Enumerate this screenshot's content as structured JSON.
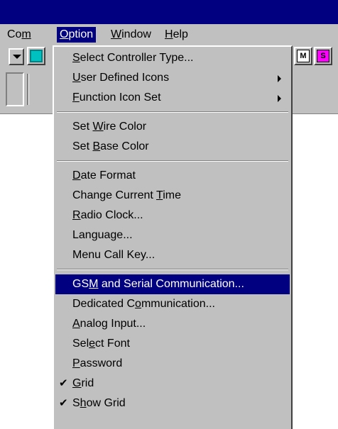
{
  "menubar": {
    "items": [
      {
        "label": "Com",
        "mnemonic_index": 2
      },
      {
        "label": "Option",
        "mnemonic_index": 0,
        "active": true
      },
      {
        "label": "Window",
        "mnemonic_index": 0
      },
      {
        "label": "Help",
        "mnemonic_index": 0
      }
    ]
  },
  "toolbar": {
    "icons": [
      {
        "name": "toolbar-partial-icon",
        "glyph": "",
        "color": "#008080"
      },
      {
        "name": "toolbar-m-icon",
        "glyph": "M",
        "color": "#000000"
      },
      {
        "name": "toolbar-s-icon",
        "glyph": "S",
        "color": "#800080"
      }
    ]
  },
  "option_menu": {
    "groups": [
      [
        {
          "label": "Select Controller Type...",
          "mnemonic_index": 0,
          "submenu": false
        },
        {
          "label": "User Defined Icons",
          "mnemonic_index": 0,
          "submenu": true
        },
        {
          "label": "Function Icon Set",
          "mnemonic_index": 0,
          "submenu": true
        }
      ],
      [
        {
          "label": "Set Wire Color",
          "mnemonic_index": 4,
          "submenu": false
        },
        {
          "label": "Set Base Color",
          "mnemonic_index": 4,
          "submenu": false
        }
      ],
      [
        {
          "label": "Date Format",
          "mnemonic_index": 0,
          "submenu": false
        },
        {
          "label": "Change Current Time",
          "mnemonic_index": 15,
          "submenu": false
        },
        {
          "label": "Radio Clock...",
          "mnemonic_index": 0,
          "submenu": false
        },
        {
          "label": "Language...",
          "mnemonic_index": -1,
          "submenu": false
        },
        {
          "label": "Menu Call Key...",
          "mnemonic_index": -1,
          "submenu": false
        }
      ],
      [
        {
          "label": "GSM and Serial Communication...",
          "mnemonic_index": 2,
          "submenu": false,
          "highlighted": true
        },
        {
          "label": "Dedicated Communication...",
          "mnemonic_index": 11,
          "submenu": false
        },
        {
          "label": "Analog Input...",
          "mnemonic_index": 0,
          "submenu": false
        },
        {
          "label": "Select Font",
          "mnemonic_index": 3,
          "submenu": false
        },
        {
          "label": "Password",
          "mnemonic_index": 0,
          "submenu": false
        },
        {
          "label": "Grid",
          "mnemonic_index": 0,
          "submenu": false,
          "checked": true
        },
        {
          "label": "Show Grid",
          "mnemonic_index": 1,
          "submenu": false,
          "checked": true
        }
      ]
    ]
  },
  "colors": {
    "highlight": "#000080",
    "face": "#c0c0c0",
    "titlebar": "#000080"
  }
}
